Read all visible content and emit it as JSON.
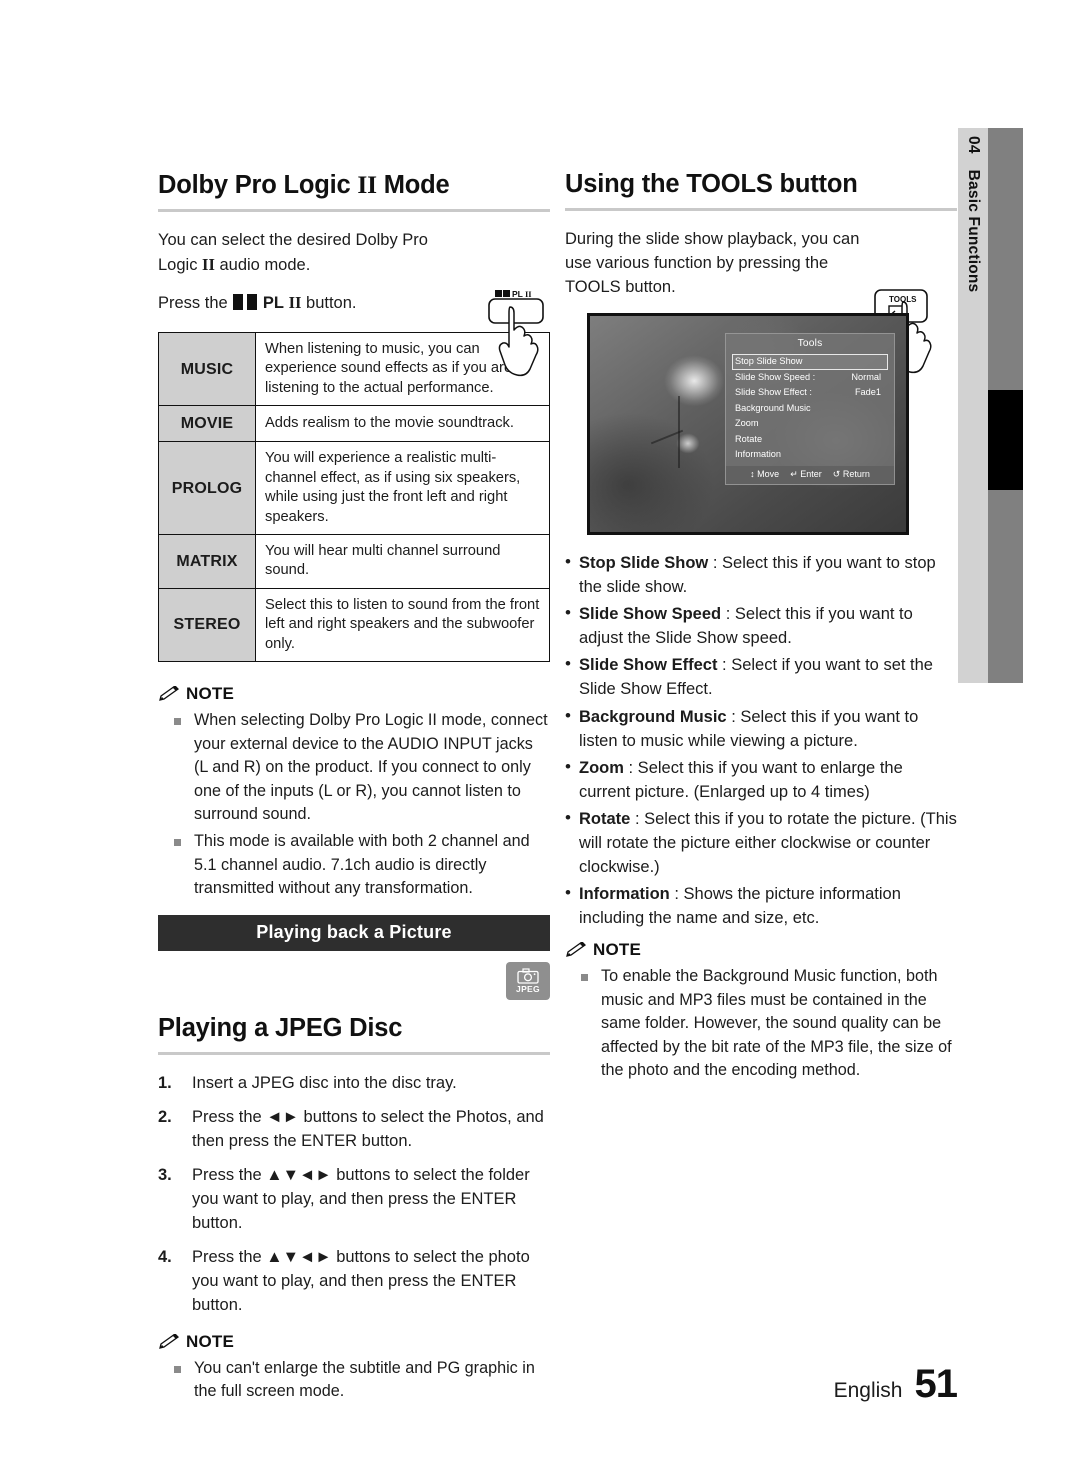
{
  "chapter_tab": {
    "number": "04",
    "label": "Basic Functions"
  },
  "left_column": {
    "section_title_a": "Dolby Pro Logic",
    "section_title_a_suffix": "Mode",
    "intro_line1": "You can select the desired Dolby Pro",
    "intro_line2": "audio mode.",
    "intro_logic": "Logic",
    "press_prefix": "Press the",
    "press_button": "PL",
    "press_suffix": "button.",
    "button_illustration_label": "PL",
    "modes_table": [
      {
        "name": "MUSIC",
        "desc": "When listening to music, you can experience sound effects as if you are listening to the actual performance."
      },
      {
        "name": "MOVIE",
        "desc": "Adds realism to the movie soundtrack."
      },
      {
        "name": "PROLOG",
        "desc": "You will experience a realistic multi-channel effect, as if using six speakers, while using just the front left and right speakers."
      },
      {
        "name": "MATRIX",
        "desc": "You will hear multi channel surround sound."
      },
      {
        "name": "STEREO",
        "desc": "Select this to listen to sound from the front left and right speakers and the subwoofer only."
      }
    ],
    "note_label": "NOTE",
    "notes": [
      "When selecting Dolby Pro Logic II mode, connect your external device to the AUDIO INPUT jacks (L and R) on the product. If you connect to only one of the inputs (L or R), you cannot listen to surround sound.",
      "This mode is available with both 2 channel and 5.1 channel audio. 7.1ch audio is directly transmitted without any transformation."
    ],
    "banner": "Playing back a Picture",
    "jpeg_badge_label": "JPEG",
    "section_title_b": "Playing a JPEG Disc",
    "steps": [
      {
        "num": "1.",
        "text": "Insert a JPEG disc into the disc tray."
      },
      {
        "num": "2.",
        "text": "Press the ◄► buttons to select the Photos, and then press the ENTER button."
      },
      {
        "num": "3.",
        "text": "Press the ▲▼◄► buttons to select the folder you want to play, and then press the ENTER button."
      },
      {
        "num": "4.",
        "text": "Press the ▲▼◄► buttons to select the photo you want to play, and then press the ENTER button."
      }
    ],
    "note_label_2": "NOTE",
    "notes_2": [
      "You can't enlarge the subtitle and PG graphic in the full screen mode."
    ]
  },
  "right_column": {
    "section_title": "Using the TOOLS button",
    "intro": "During the slide show playback, you can use various function by pressing the TOOLS button.",
    "intro_bold": "TOOLS",
    "button_illustration_label": "TOOLS",
    "tv_screenshot": {
      "menu_title": "Tools",
      "items": [
        {
          "label": "Stop Slide Show",
          "value": "",
          "selected": true
        },
        {
          "label": "Slide Show Speed :",
          "value": "Normal",
          "selected": false
        },
        {
          "label": "Slide Show Effect  :",
          "value": "Fade1",
          "selected": false
        },
        {
          "label": "Background Music",
          "value": "",
          "selected": false
        },
        {
          "label": "Zoom",
          "value": "",
          "selected": false
        },
        {
          "label": "Rotate",
          "value": "",
          "selected": false
        },
        {
          "label": "Information",
          "value": "",
          "selected": false
        }
      ],
      "footer": [
        {
          "icon": "↕",
          "label": "Move"
        },
        {
          "icon": "↵",
          "label": "Enter"
        },
        {
          "icon": "↺",
          "label": "Return"
        }
      ]
    },
    "tools_list": [
      {
        "term": "Stop Slide Show",
        "desc": ": Select this if you want to stop the slide show."
      },
      {
        "term": "Slide Show Speed",
        "desc": ": Select this if you want to adjust the Slide Show speed."
      },
      {
        "term": "Slide Show Effect",
        "desc": ": Select if you want to set the Slide Show Effect."
      },
      {
        "term": "Background Music",
        "desc": ": Select this if you want to listen to music while viewing a picture."
      },
      {
        "term": "Zoom",
        "desc": ": Select this if you want to enlarge the current picture. (Enlarged up to 4 times)"
      },
      {
        "term": "Rotate",
        "desc": ": Select this if you to rotate the picture. (This will rotate the picture either clockwise or counter clockwise.)"
      },
      {
        "term": "Information",
        "desc": ": Shows the picture information including the name and size, etc."
      }
    ],
    "note_label": "NOTE",
    "notes": [
      "To enable the Background Music function, both music and MP3 files must be contained in the same folder. However, the sound quality can be affected by the bit rate of the MP3 file, the size of the photo and the encoding method."
    ]
  },
  "footer": {
    "language": "English",
    "page_number": "51"
  }
}
